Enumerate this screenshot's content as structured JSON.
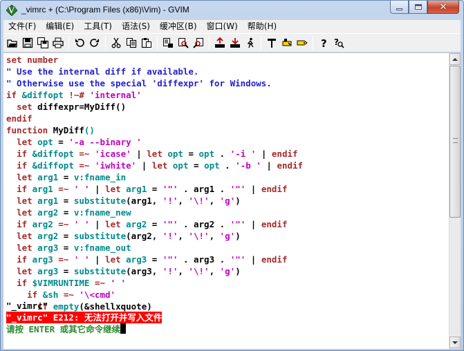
{
  "window": {
    "title": "_vimrc + (C:\\Program Files (x86)\\Vim) - GVIM"
  },
  "menu": [
    {
      "id": "file",
      "label": "文件(F)"
    },
    {
      "id": "edit",
      "label": "编辑(E)"
    },
    {
      "id": "tools",
      "label": "工具(T)"
    },
    {
      "id": "syntax",
      "label": "语法(S)"
    },
    {
      "id": "buffers",
      "label": "缓冲区(B)"
    },
    {
      "id": "window",
      "label": "窗口(W)"
    },
    {
      "id": "help",
      "label": "帮助(H)"
    }
  ],
  "toolbar_icons": [
    "open-icon",
    "save-icon",
    "save-all-icon",
    "print-icon",
    "undo-icon",
    "redo-icon",
    "cut-icon",
    "copy-icon",
    "paste-icon",
    "replace-icon",
    "find-next-icon",
    "find-prev-icon",
    "load-session-icon",
    "save-session-icon",
    "run-script-icon",
    "make-icon",
    "shell-icon",
    "tag-jump-icon",
    "help-icon",
    "find-help-icon"
  ],
  "editor": {
    "lines": [
      [
        [
          "kw",
          "set"
        ],
        [
          "nm",
          " "
        ],
        [
          "kw",
          "number"
        ]
      ],
      [
        [
          "cm",
          "\" Use the internal diff if available."
        ]
      ],
      [
        [
          "cm",
          "\" Otherwise use the special 'diffexpr' for Windows."
        ]
      ],
      [
        [
          "kw",
          "if"
        ],
        [
          "nm",
          " "
        ],
        [
          "fn",
          "&diffopt"
        ],
        [
          "nm",
          " "
        ],
        [
          "kw",
          "!~#"
        ],
        [
          "nm",
          " "
        ],
        [
          "st",
          "'internal'"
        ]
      ],
      [
        [
          "nm",
          "  "
        ],
        [
          "kw",
          "set"
        ],
        [
          "nm",
          " diffexpr=MyDiff()"
        ]
      ],
      [
        [
          "kw",
          "endif"
        ]
      ],
      [
        [
          "kw",
          "function"
        ],
        [
          "nm",
          " MyDiff"
        ],
        [
          "fn",
          "()"
        ]
      ],
      [
        [
          "nm",
          "  "
        ],
        [
          "kw",
          "let"
        ],
        [
          "nm",
          " "
        ],
        [
          "fn",
          "opt"
        ],
        [
          "nm",
          " = "
        ],
        [
          "st",
          "'-a --binary '"
        ]
      ],
      [
        [
          "nm",
          "  "
        ],
        [
          "kw",
          "if"
        ],
        [
          "nm",
          " "
        ],
        [
          "fn",
          "&diffopt"
        ],
        [
          "nm",
          " "
        ],
        [
          "kw",
          "=~"
        ],
        [
          "nm",
          " "
        ],
        [
          "st",
          "'icase'"
        ],
        [
          "nm",
          " | "
        ],
        [
          "kw",
          "let"
        ],
        [
          "nm",
          " "
        ],
        [
          "fn",
          "opt"
        ],
        [
          "nm",
          " = "
        ],
        [
          "fn",
          "opt"
        ],
        [
          "nm",
          " . "
        ],
        [
          "st",
          "'-i '"
        ],
        [
          "nm",
          " | "
        ],
        [
          "kw",
          "endif"
        ]
      ],
      [
        [
          "nm",
          "  "
        ],
        [
          "kw",
          "if"
        ],
        [
          "nm",
          " "
        ],
        [
          "fn",
          "&diffopt"
        ],
        [
          "nm",
          " "
        ],
        [
          "kw",
          "=~"
        ],
        [
          "nm",
          " "
        ],
        [
          "st",
          "'iwhite'"
        ],
        [
          "nm",
          " | "
        ],
        [
          "kw",
          "let"
        ],
        [
          "nm",
          " "
        ],
        [
          "fn",
          "opt"
        ],
        [
          "nm",
          " = "
        ],
        [
          "fn",
          "opt"
        ],
        [
          "nm",
          " . "
        ],
        [
          "st",
          "'-b '"
        ],
        [
          "nm",
          " | "
        ],
        [
          "kw",
          "endif"
        ]
      ],
      [
        [
          "nm",
          "  "
        ],
        [
          "kw",
          "let"
        ],
        [
          "nm",
          " "
        ],
        [
          "fn",
          "arg1"
        ],
        [
          "nm",
          " = "
        ],
        [
          "fn",
          "v:fname_in"
        ]
      ],
      [
        [
          "nm",
          "  "
        ],
        [
          "kw",
          "if"
        ],
        [
          "nm",
          " "
        ],
        [
          "fn",
          "arg1"
        ],
        [
          "nm",
          " "
        ],
        [
          "kw",
          "=~"
        ],
        [
          "nm",
          " "
        ],
        [
          "st",
          "' '"
        ],
        [
          "nm",
          " | "
        ],
        [
          "kw",
          "let"
        ],
        [
          "nm",
          " "
        ],
        [
          "fn",
          "arg1"
        ],
        [
          "nm",
          " = "
        ],
        [
          "st",
          "'\"'"
        ],
        [
          "nm",
          " . arg1 . "
        ],
        [
          "st",
          "'\"'"
        ],
        [
          "nm",
          " | "
        ],
        [
          "kw",
          "endif"
        ]
      ],
      [
        [
          "nm",
          "  "
        ],
        [
          "kw",
          "let"
        ],
        [
          "nm",
          " "
        ],
        [
          "fn",
          "arg1"
        ],
        [
          "nm",
          " = "
        ],
        [
          "fn",
          "substitute"
        ],
        [
          "nm",
          "(arg1, "
        ],
        [
          "st",
          "'!'"
        ],
        [
          "nm",
          ", "
        ],
        [
          "st",
          "'\\!'"
        ],
        [
          "nm",
          ", "
        ],
        [
          "st",
          "'g'"
        ],
        [
          "nm",
          ")"
        ]
      ],
      [
        [
          "nm",
          "  "
        ],
        [
          "kw",
          "let"
        ],
        [
          "nm",
          " "
        ],
        [
          "fn",
          "arg2"
        ],
        [
          "nm",
          " = "
        ],
        [
          "fn",
          "v:fname_new"
        ]
      ],
      [
        [
          "nm",
          "  "
        ],
        [
          "kw",
          "if"
        ],
        [
          "nm",
          " "
        ],
        [
          "fn",
          "arg2"
        ],
        [
          "nm",
          " "
        ],
        [
          "kw",
          "=~"
        ],
        [
          "nm",
          " "
        ],
        [
          "st",
          "' '"
        ],
        [
          "nm",
          " | "
        ],
        [
          "kw",
          "let"
        ],
        [
          "nm",
          " "
        ],
        [
          "fn",
          "arg2"
        ],
        [
          "nm",
          " = "
        ],
        [
          "st",
          "'\"'"
        ],
        [
          "nm",
          " . arg2 . "
        ],
        [
          "st",
          "'\"'"
        ],
        [
          "nm",
          " | "
        ],
        [
          "kw",
          "endif"
        ]
      ],
      [
        [
          "nm",
          "  "
        ],
        [
          "kw",
          "let"
        ],
        [
          "nm",
          " "
        ],
        [
          "fn",
          "arg2"
        ],
        [
          "nm",
          " = "
        ],
        [
          "fn",
          "substitute"
        ],
        [
          "nm",
          "(arg2, "
        ],
        [
          "st",
          "'!'"
        ],
        [
          "nm",
          ", "
        ],
        [
          "st",
          "'\\!'"
        ],
        [
          "nm",
          ", "
        ],
        [
          "st",
          "'g'"
        ],
        [
          "nm",
          ")"
        ]
      ],
      [
        [
          "nm",
          "  "
        ],
        [
          "kw",
          "let"
        ],
        [
          "nm",
          " "
        ],
        [
          "fn",
          "arg3"
        ],
        [
          "nm",
          " = "
        ],
        [
          "fn",
          "v:fname_out"
        ]
      ],
      [
        [
          "nm",
          "  "
        ],
        [
          "kw",
          "if"
        ],
        [
          "nm",
          " "
        ],
        [
          "fn",
          "arg3"
        ],
        [
          "nm",
          " "
        ],
        [
          "kw",
          "=~"
        ],
        [
          "nm",
          " "
        ],
        [
          "st",
          "' '"
        ],
        [
          "nm",
          " | "
        ],
        [
          "kw",
          "let"
        ],
        [
          "nm",
          " "
        ],
        [
          "fn",
          "arg3"
        ],
        [
          "nm",
          " = "
        ],
        [
          "st",
          "'\"'"
        ],
        [
          "nm",
          " . arg3 . "
        ],
        [
          "st",
          "'\"'"
        ],
        [
          "nm",
          " | "
        ],
        [
          "kw",
          "endif"
        ]
      ],
      [
        [
          "nm",
          "  "
        ],
        [
          "kw",
          "let"
        ],
        [
          "nm",
          " "
        ],
        [
          "fn",
          "arg3"
        ],
        [
          "nm",
          " = "
        ],
        [
          "fn",
          "substitute"
        ],
        [
          "nm",
          "(arg3, "
        ],
        [
          "st",
          "'!'"
        ],
        [
          "nm",
          ", "
        ],
        [
          "st",
          "'\\!'"
        ],
        [
          "nm",
          ", "
        ],
        [
          "st",
          "'g'"
        ],
        [
          "nm",
          ")"
        ]
      ],
      [
        [
          "nm",
          "  "
        ],
        [
          "kw",
          "if"
        ],
        [
          "nm",
          " "
        ],
        [
          "fn",
          "$VIMRUNTIME"
        ],
        [
          "nm",
          " "
        ],
        [
          "kw",
          "=~"
        ],
        [
          "nm",
          " "
        ],
        [
          "st",
          "' '"
        ]
      ],
      [
        [
          "nm",
          "    "
        ],
        [
          "kw",
          "if"
        ],
        [
          "nm",
          " "
        ],
        [
          "fn",
          "&sh"
        ],
        [
          "nm",
          " "
        ],
        [
          "kw",
          "=~"
        ],
        [
          "nm",
          " "
        ],
        [
          "st",
          "'\\<cmd'"
        ]
      ],
      [
        [
          "nm",
          "      "
        ],
        [
          "kw",
          "if"
        ],
        [
          "nm",
          " "
        ],
        [
          "fn",
          "empty"
        ],
        [
          "nm",
          "(&shellxquote)"
        ]
      ]
    ],
    "status_line": "\"_vimrc\"",
    "error_message": "\"_vimrc\" E212: 无法打开并写入文件",
    "prompt": "请按 ENTER 或其它命令继续"
  }
}
